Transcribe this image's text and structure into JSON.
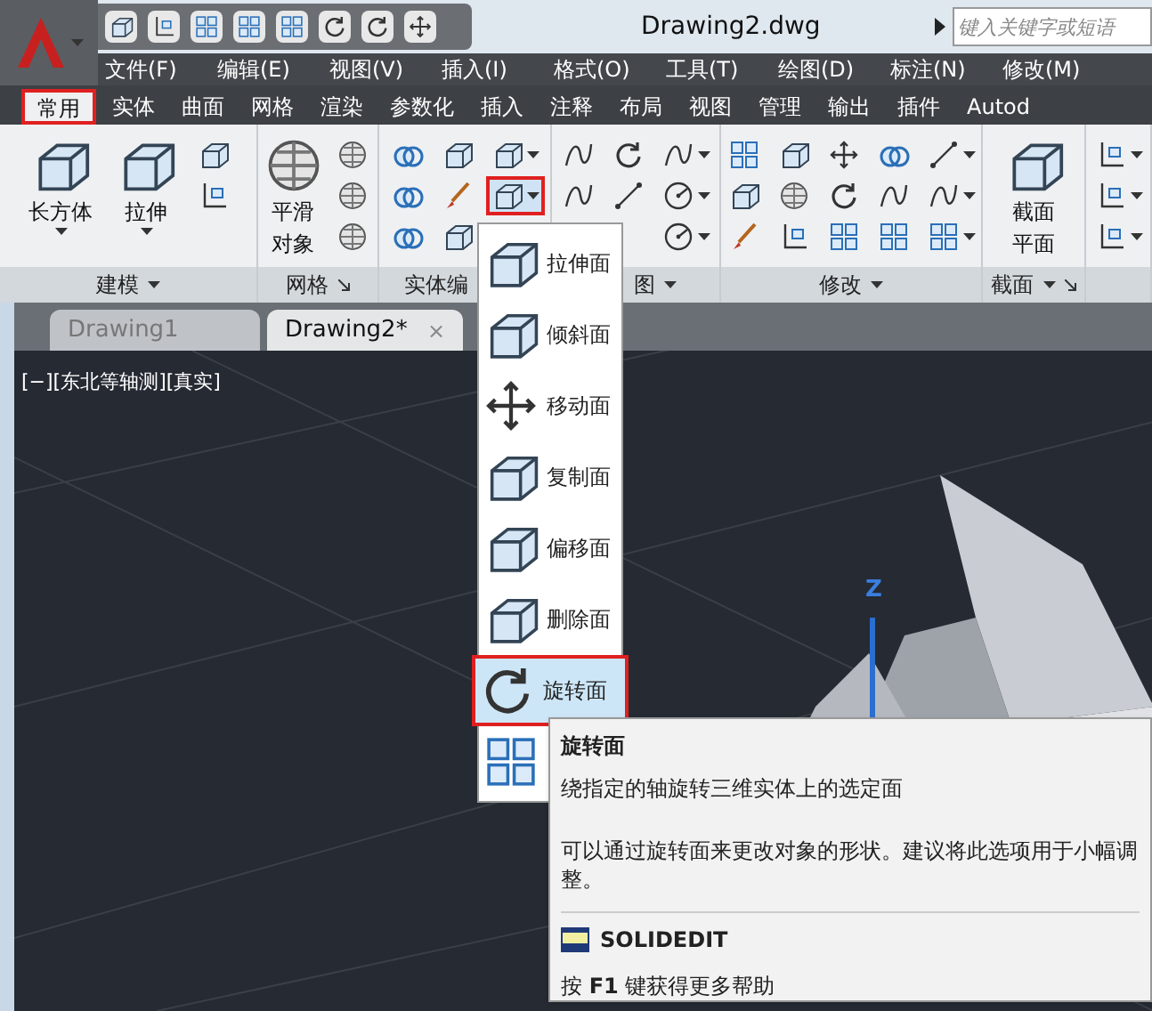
{
  "window": {
    "title": "Drawing2.dwg"
  },
  "search": {
    "placeholder": "键入关键字或短语"
  },
  "menu_bar": [
    "文件(F)",
    "编辑(E)",
    "视图(V)",
    "插入(I)",
    "格式(O)",
    "工具(T)",
    "绘图(D)",
    "标注(N)",
    "修改(M)"
  ],
  "ribbon_tabs": [
    {
      "label": "常用",
      "selected": true
    },
    {
      "label": "实体",
      "selected": false
    },
    {
      "label": "曲面",
      "selected": false
    },
    {
      "label": "网格",
      "selected": false
    },
    {
      "label": "渲染",
      "selected": false
    },
    {
      "label": "参数化",
      "selected": false
    },
    {
      "label": "插入",
      "selected": false
    },
    {
      "label": "注释",
      "selected": false
    },
    {
      "label": "布局",
      "selected": false
    },
    {
      "label": "视图",
      "selected": false
    },
    {
      "label": "管理",
      "selected": false
    },
    {
      "label": "输出",
      "selected": false
    },
    {
      "label": "插件",
      "selected": false
    },
    {
      "label": "Autod",
      "selected": false
    }
  ],
  "ribbon_panels": [
    {
      "label": "建模",
      "dropdown": true,
      "launcher": false,
      "tools": [
        {
          "label": "长方体",
          "dropdown": true
        },
        {
          "label": "拉伸",
          "dropdown": true
        }
      ]
    },
    {
      "label": "网格",
      "dropdown": false,
      "launcher": true,
      "tools": [
        {
          "label": "平滑对象",
          "dropdown": false
        }
      ]
    },
    {
      "label": "实体编",
      "dropdown": false,
      "launcher": false,
      "split_highlighted": true
    },
    {
      "label": "图",
      "dropdown": true,
      "launcher": false
    },
    {
      "label": "修改",
      "dropdown": true,
      "launcher": false
    },
    {
      "label": "截面",
      "dropdown": true,
      "launcher": true,
      "tools": [
        {
          "label": "截面平面",
          "dropdown": false
        }
      ]
    },
    {
      "dropdown": false,
      "launcher": false
    }
  ],
  "doc_tabs": [
    {
      "label": "Drawing1",
      "selected": false
    },
    {
      "label": "Drawing2*",
      "selected": true,
      "close": "×"
    }
  ],
  "viewport": {
    "label": "[−][东北等轴测][真实]",
    "axis_label": "Z"
  },
  "face_menu": [
    {
      "label": "拉伸面",
      "selected": false
    },
    {
      "label": "倾斜面",
      "selected": false
    },
    {
      "label": "移动面",
      "selected": false
    },
    {
      "label": "复制面",
      "selected": false
    },
    {
      "label": "偏移面",
      "selected": false
    },
    {
      "label": "删除面",
      "selected": false
    },
    {
      "label": "旋转面",
      "selected": true
    },
    {
      "selected": false
    }
  ],
  "tooltip": {
    "title": "旋转面",
    "description": "绕指定的轴旋转三维实体上的选定面",
    "note": "可以通过旋转面来更改对象的形状。建议将此选项用于小幅调整。",
    "command": "SOLIDEDIT",
    "help": "按 **F1** 键获得更多帮助"
  }
}
